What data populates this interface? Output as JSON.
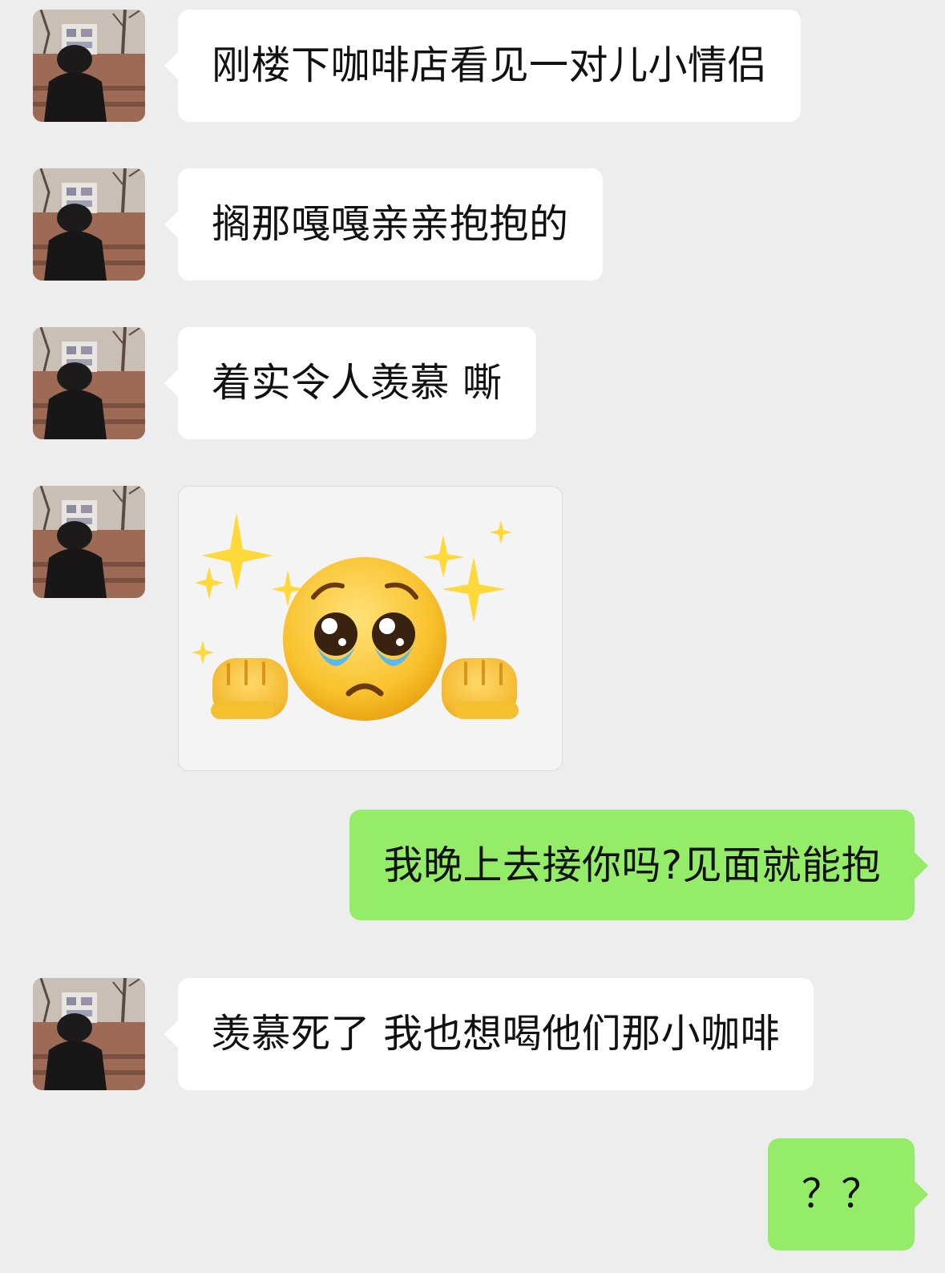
{
  "chat": {
    "contact_avatar_icon": "contact-avatar-photo",
    "colors": {
      "background": "#ededed",
      "incoming_bubble": "#ffffff",
      "outgoing_bubble": "#95ec69",
      "text": "#111111"
    },
    "messages": [
      {
        "direction": "incoming",
        "type": "text",
        "text": "刚楼下咖啡店看见一对儿小情侣"
      },
      {
        "direction": "incoming",
        "type": "text",
        "text": "搁那嘎嘎亲亲抱抱的"
      },
      {
        "direction": "incoming",
        "type": "text",
        "text": "着实令人羡慕 嘶"
      },
      {
        "direction": "incoming",
        "type": "sticker",
        "sticker_icon": "pleading-face-sparkles-sticker"
      },
      {
        "direction": "outgoing",
        "type": "text",
        "text": "我晚上去接你吗?见面就能抱"
      },
      {
        "direction": "incoming",
        "type": "text",
        "text": "羡慕死了 我也想喝他们那小咖啡"
      },
      {
        "direction": "outgoing",
        "type": "text",
        "text": "？？"
      }
    ]
  }
}
